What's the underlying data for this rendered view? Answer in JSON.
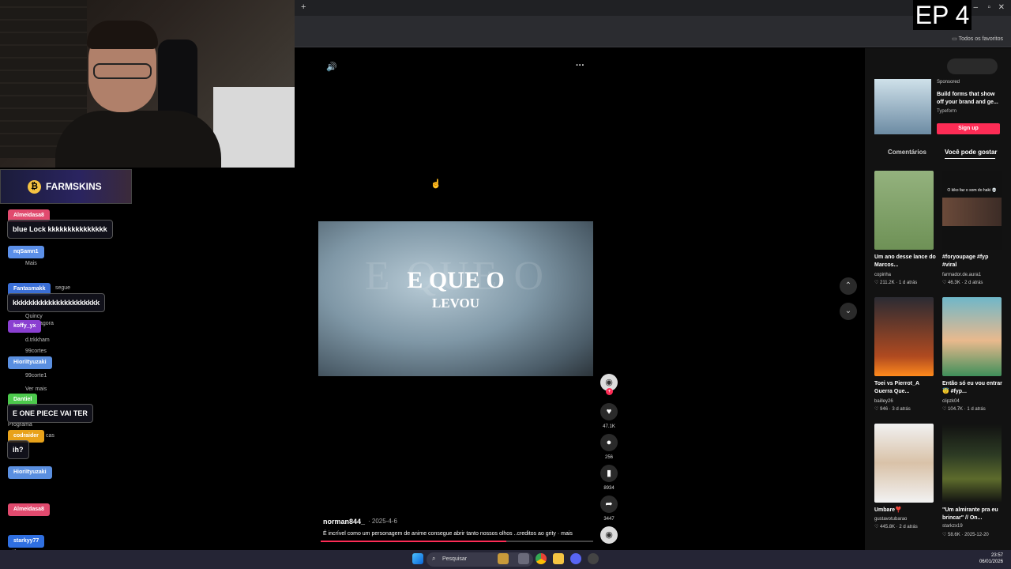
{
  "browser": {
    "new_tab": "+",
    "favorites": "Todos os favoritos",
    "window_controls": [
      "–",
      "▫",
      "✕"
    ]
  },
  "overlay": {
    "episode_badge": "EP 4"
  },
  "sponsor": {
    "name": "FARMSKINS",
    "coin": "₿"
  },
  "chat": [
    {
      "user": "Almeidasa8",
      "color": "#e14a6e",
      "message": "blue Lock kkkkkkkkkkkkkkk"
    },
    {
      "user": "nqSamn1",
      "color": "#5b8fe8",
      "message": ""
    },
    {
      "user": "Fantasmakk",
      "color": "#3b6fd6",
      "message": "kkkkkkkkkkkkkkkkkkkkkk"
    },
    {
      "user": "koffy_yx",
      "color": "#8a3fd1",
      "message": ""
    },
    {
      "user": "HioriItyuzaki",
      "color": "#5a8fe0",
      "message": ""
    },
    {
      "user": "Dantiel",
      "color": "#4cc94c",
      "message": "E ONE PIECE VAI TER"
    },
    {
      "user": "codraider",
      "color": "#e8a21a",
      "message": "ih?"
    },
    {
      "user": "HioriItyuzaki",
      "color": "#5a8fe0",
      "message": ""
    },
    {
      "user": "Almeidasa8",
      "color": "#e14a6e",
      "message": ""
    },
    {
      "user": "starkyy77",
      "color": "#2f6fe0",
      "message": "tira"
    }
  ],
  "chat_ghost": [
    "Mais",
    "segue",
    "Quincy",
    "agora",
    "d.trkkham",
    "99cortes",
    "99corte1",
    "Ver mais",
    "Programa",
    "cas"
  ],
  "player": {
    "mute_icon": "🔊",
    "more_icon": "···",
    "video_text_main": "E QUE O",
    "video_text_sub": "LEVOU",
    "video_text_ghost": "E QUE O",
    "actions": [
      {
        "name": "like",
        "glyph": "♥",
        "count": "47.1K"
      },
      {
        "name": "comment",
        "glyph": "●",
        "count": "256"
      },
      {
        "name": "bookmark",
        "glyph": "▮",
        "count": "8934"
      },
      {
        "name": "share",
        "glyph": "➦",
        "count": "3447"
      }
    ],
    "author": "norman844_",
    "date": "· 2025-4-6",
    "caption": "É incrível como um personagem de anime consegue abrir tanto nossos olhos ..creditos ao grity ·  mais",
    "progress": 0.68,
    "nav_up": "⌃",
    "nav_down": "⌄"
  },
  "sidebar": {
    "ad": {
      "label": "Sponsored",
      "title": "Build forms that show off your brand and ge...",
      "brand": "Typeform",
      "cta": "Sign up"
    },
    "tabs": {
      "comments": "Comentários",
      "recommend": "Você pode gostar"
    },
    "videos": [
      {
        "title": "Um ano desse lance do Marcos...",
        "author": "copinha",
        "likes": "♡ 211.2K",
        "age": "· 1 d atrás"
      },
      {
        "title": "#foryoupage #fyp #viral",
        "author": "farmador.de.aura1",
        "likes": "♡ 46.3K",
        "age": "· 2 d atrás",
        "overlay": "O kiko faz o som do haki 💀"
      },
      {
        "title": "Toei vs Pierrot_A Guerra Que...",
        "author": "bailley26",
        "likes": "♡ 946",
        "age": "· 3 d atrás"
      },
      {
        "title": "Então só eu vou entrar 😇 #fyp...",
        "author": "clipzk04",
        "likes": "♡ 104.7K",
        "age": "· 1 d atrás"
      },
      {
        "title": "Umbare❣️",
        "author": "gustavotubarao",
        "likes": "♡ 445.8K",
        "age": "· 2 d atrás"
      },
      {
        "title": "\"Um almirante pra eu brincar\" // On...",
        "author": "starkzx19",
        "likes": "♡ 58.6K",
        "age": "· 2025-12-20"
      }
    ]
  },
  "taskbar": {
    "search": "Pesquisar",
    "time": "23:57",
    "date": "06/01/2026"
  }
}
